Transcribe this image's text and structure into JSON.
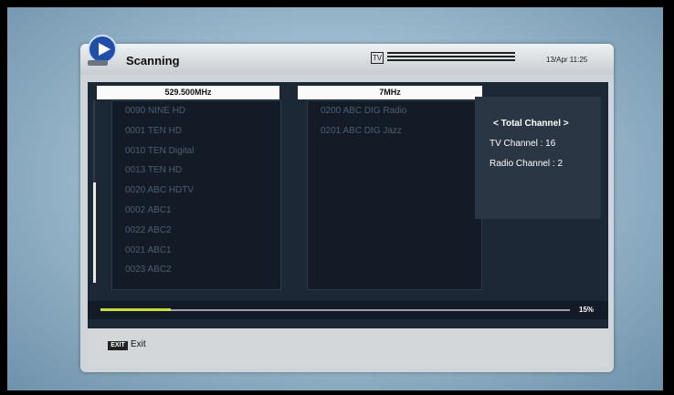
{
  "header": {
    "title": "Scanning",
    "tv_icon_label": "TV",
    "datetime": "13/Apr 11:25",
    "logo_icon": "globe-satellite-icon"
  },
  "frequency_column": {
    "label": "529.500MHz"
  },
  "bandwidth_column": {
    "label": "7MHz"
  },
  "tv_channels": [
    "0090 NINE HD",
    "0001 TEN HD",
    "0010 TEN Digital",
    "0013 TEN HD",
    "0020 ABC HDTV",
    "0002 ABC1",
    "0022 ABC2",
    "0021 ABC1",
    "0023 ABC2"
  ],
  "radio_channels": [
    "0200 ABC DIG Radio",
    "0201 ABC DIG Jazz"
  ],
  "summary": {
    "title": "< Total Channel >",
    "tv_line": "TV Channel  : 16",
    "radio_line": "Radio Channel  : 2"
  },
  "progress": {
    "fraction": 0.15,
    "label": "15%"
  },
  "footer": {
    "exit_key": "EXIT",
    "exit_label": "Exit"
  },
  "colors": {
    "accent": "#c8e03a",
    "panel": "#1d2836"
  }
}
